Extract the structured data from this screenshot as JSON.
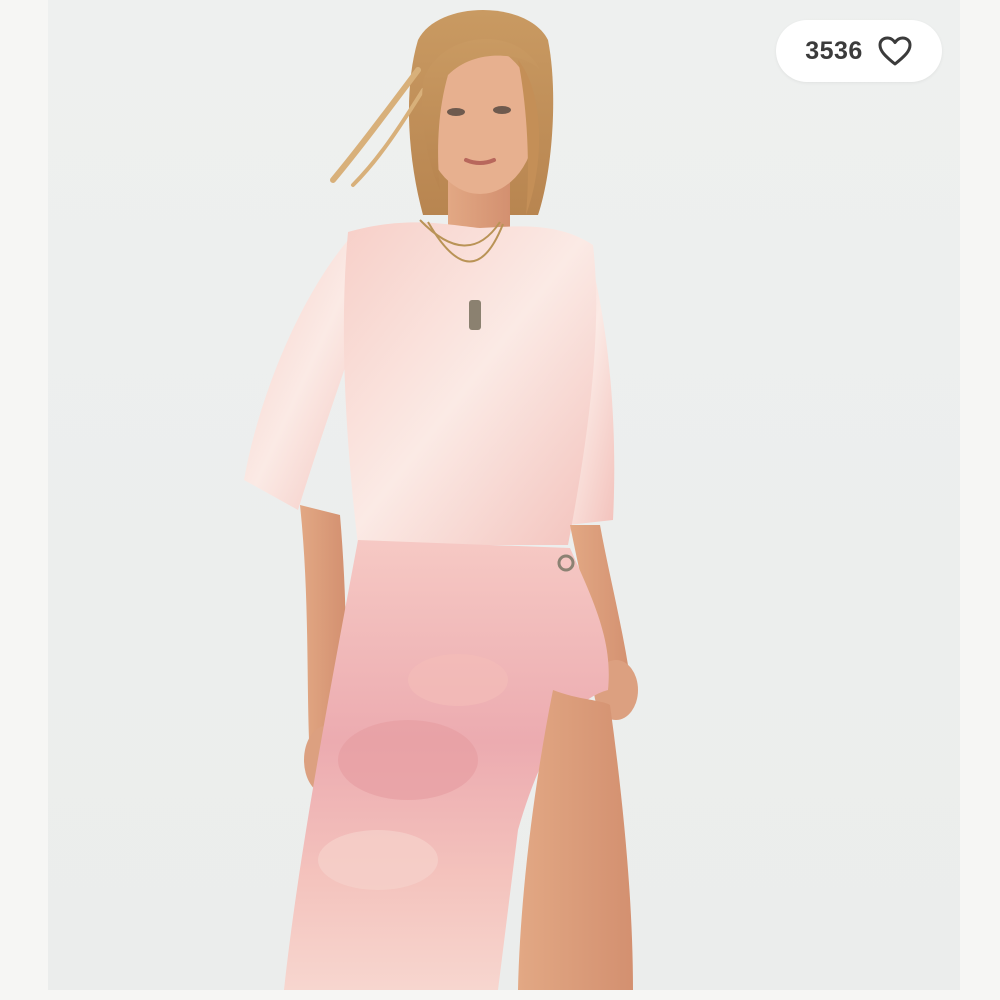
{
  "listing": {
    "like_count": "3536",
    "like_icon": "heart-outline-icon",
    "photo_subject": "product-photo"
  },
  "colors": {
    "background": "#f6f6f4",
    "pill_bg": "#ffffff",
    "text": "#3b3b3b",
    "garment_pink": "#f2b7b7",
    "garment_rose": "#e9a0a4"
  }
}
